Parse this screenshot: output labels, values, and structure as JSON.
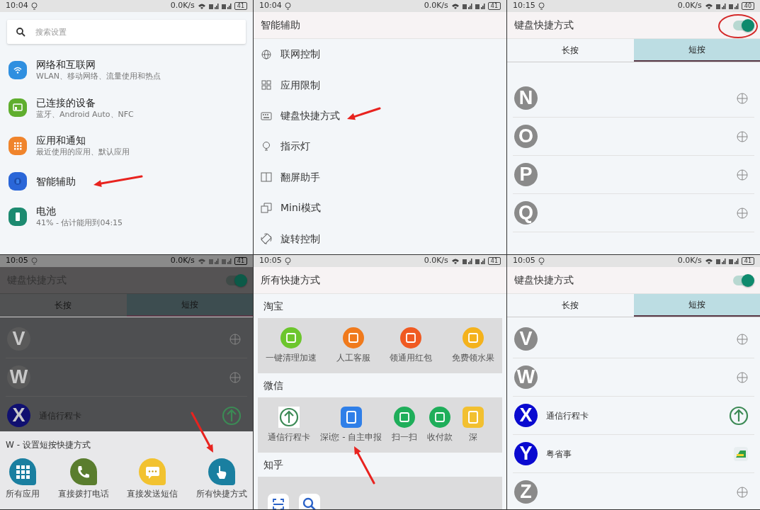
{
  "panels": [
    {
      "kind": "settings",
      "status_bar": {
        "time": "10:04",
        "speed": "0.0K/s",
        "battery": "41"
      },
      "search": {
        "placeholder": "搜索设置"
      },
      "items": [
        {
          "title": "网络和互联网",
          "subtitle": "WLAN、移动网络、流量使用和热点",
          "color": "#2f8fe0",
          "marked": false
        },
        {
          "title": "已连接的设备",
          "subtitle": "蓝牙、Android Auto、NFC",
          "color": "#5fae2e",
          "marked": false
        },
        {
          "title": "应用和通知",
          "subtitle": "最近使用的应用、默认应用",
          "color": "#f0842c",
          "marked": false
        },
        {
          "title": "智能辅助",
          "color": "#2a66d8",
          "marked": true
        },
        {
          "title": "电池",
          "subtitle": "41% - 估计能用到04:15",
          "color": "#1c8a70",
          "marked": false
        }
      ]
    },
    {
      "kind": "menu",
      "status_bar": {
        "time": "10:04",
        "speed": "0.0K/s",
        "battery": "41"
      },
      "title": "智能辅助",
      "items": [
        {
          "label": "联网控制",
          "marked": false
        },
        {
          "label": "应用限制",
          "marked": false
        },
        {
          "label": "键盘快捷方式",
          "marked": true
        },
        {
          "label": "指示灯",
          "marked": false
        },
        {
          "label": "翻屏助手",
          "marked": false
        },
        {
          "label": "Mini模式",
          "marked": false
        },
        {
          "label": "旋转控制",
          "marked": false
        }
      ]
    },
    {
      "kind": "shortcuts",
      "dimmed": false,
      "status_bar": {
        "time": "10:15",
        "speed": "0.0K/s",
        "battery": "40"
      },
      "title": "键盘快捷方式",
      "toggle": {
        "on": true,
        "circled": true
      },
      "tabs": [
        {
          "label": "长按",
          "selected": false
        },
        {
          "label": "短按",
          "selected": true
        }
      ],
      "rows": [
        {
          "letter": "N",
          "color": "#8a8a8a",
          "kind": "add"
        },
        {
          "letter": "O",
          "color": "#8a8a8a",
          "kind": "add"
        },
        {
          "letter": "P",
          "color": "#8a8a8a",
          "kind": "add"
        },
        {
          "letter": "Q",
          "color": "#8a8a8a",
          "kind": "add"
        }
      ]
    },
    {
      "kind": "shortcuts",
      "dimmed": true,
      "status_bar": {
        "time": "10:05",
        "speed": "0.0K/s",
        "battery": "41"
      },
      "title": "键盘快捷方式",
      "toggle": {
        "on": true,
        "circled": false
      },
      "tabs": [
        {
          "label": "长按",
          "selected": false
        },
        {
          "label": "短按",
          "selected": true
        }
      ],
      "rows": [
        {
          "letter": "V",
          "color": "#5a5a5a",
          "kind": "add"
        },
        {
          "letter": "W",
          "color": "#5a5a5a",
          "kind": "add"
        },
        {
          "letter": "X",
          "color": "#101070",
          "app": "通信行程卡",
          "kind": "arrow"
        }
      ],
      "sheet": {
        "title": "W - 设置短按快捷方式",
        "options": [
          {
            "label": "所有应用",
            "color": "#1a7fa0",
            "marked": false
          },
          {
            "label": "直接拨打电话",
            "color": "#5a7d2e",
            "marked": false
          },
          {
            "label": "直接发送短信",
            "color": "#f2c230",
            "marked": false
          },
          {
            "label": "所有快捷方式",
            "color": "#1a7fa0",
            "marked": true
          }
        ]
      }
    },
    {
      "kind": "catalog",
      "status_bar": {
        "time": "10:05",
        "speed": "0.0K/s",
        "battery": "41"
      },
      "title": "所有快捷方式",
      "groups": [
        {
          "name": "淘宝",
          "items": [
            {
              "label": "一键清理加速",
              "kind": "circle",
              "color": "#6cc62c",
              "marked": false
            },
            {
              "label": "人工客服",
              "kind": "circle",
              "color": "#f07a1c",
              "marked": false
            },
            {
              "label": "领通用红包",
              "kind": "circle",
              "color": "#f05a22",
              "marked": false
            },
            {
              "label": "免费领水果",
              "kind": "circle",
              "color": "#f4b21c",
              "marked": false
            }
          ]
        },
        {
          "name": "微信",
          "items": [
            {
              "label": "通信行程卡",
              "kind": "arrow",
              "marked": false
            },
            {
              "label": "深i您 - 自主申报",
              "kind": "tile",
              "color": "#2f7fe8",
              "marked": true
            },
            {
              "label": "扫一扫",
              "kind": "circle",
              "color": "#1fae5a",
              "marked": false
            },
            {
              "label": "收付款",
              "kind": "circle",
              "color": "#1fae5a",
              "marked": false
            },
            {
              "label": "深",
              "kind": "tile",
              "color": "#f2c030",
              "marked": false
            }
          ]
        },
        {
          "name": "知乎",
          "items": [
            {
              "kind": "scan",
              "marked": false
            },
            {
              "kind": "search",
              "marked": false
            }
          ]
        }
      ]
    },
    {
      "kind": "shortcuts",
      "dimmed": false,
      "status_bar": {
        "time": "10:05",
        "speed": "0.0K/s",
        "battery": "41"
      },
      "title": "键盘快捷方式",
      "toggle": {
        "on": true,
        "circled": false
      },
      "tabs": [
        {
          "label": "长按",
          "selected": false
        },
        {
          "label": "短按",
          "selected": true
        }
      ],
      "rows": [
        {
          "letter": "V",
          "color": "#8a8a8a",
          "kind": "add"
        },
        {
          "letter": "W",
          "color": "#8a8a8a",
          "kind": "add"
        },
        {
          "letter": "X",
          "color": "#0a0ad0",
          "app": "通信行程卡",
          "kind": "arrow"
        },
        {
          "letter": "Y",
          "color": "#0a0ad0",
          "app": "粤省事",
          "kind": "tile"
        },
        {
          "letter": "Z",
          "color": "#8a8a8a",
          "kind": "add"
        }
      ]
    }
  ]
}
